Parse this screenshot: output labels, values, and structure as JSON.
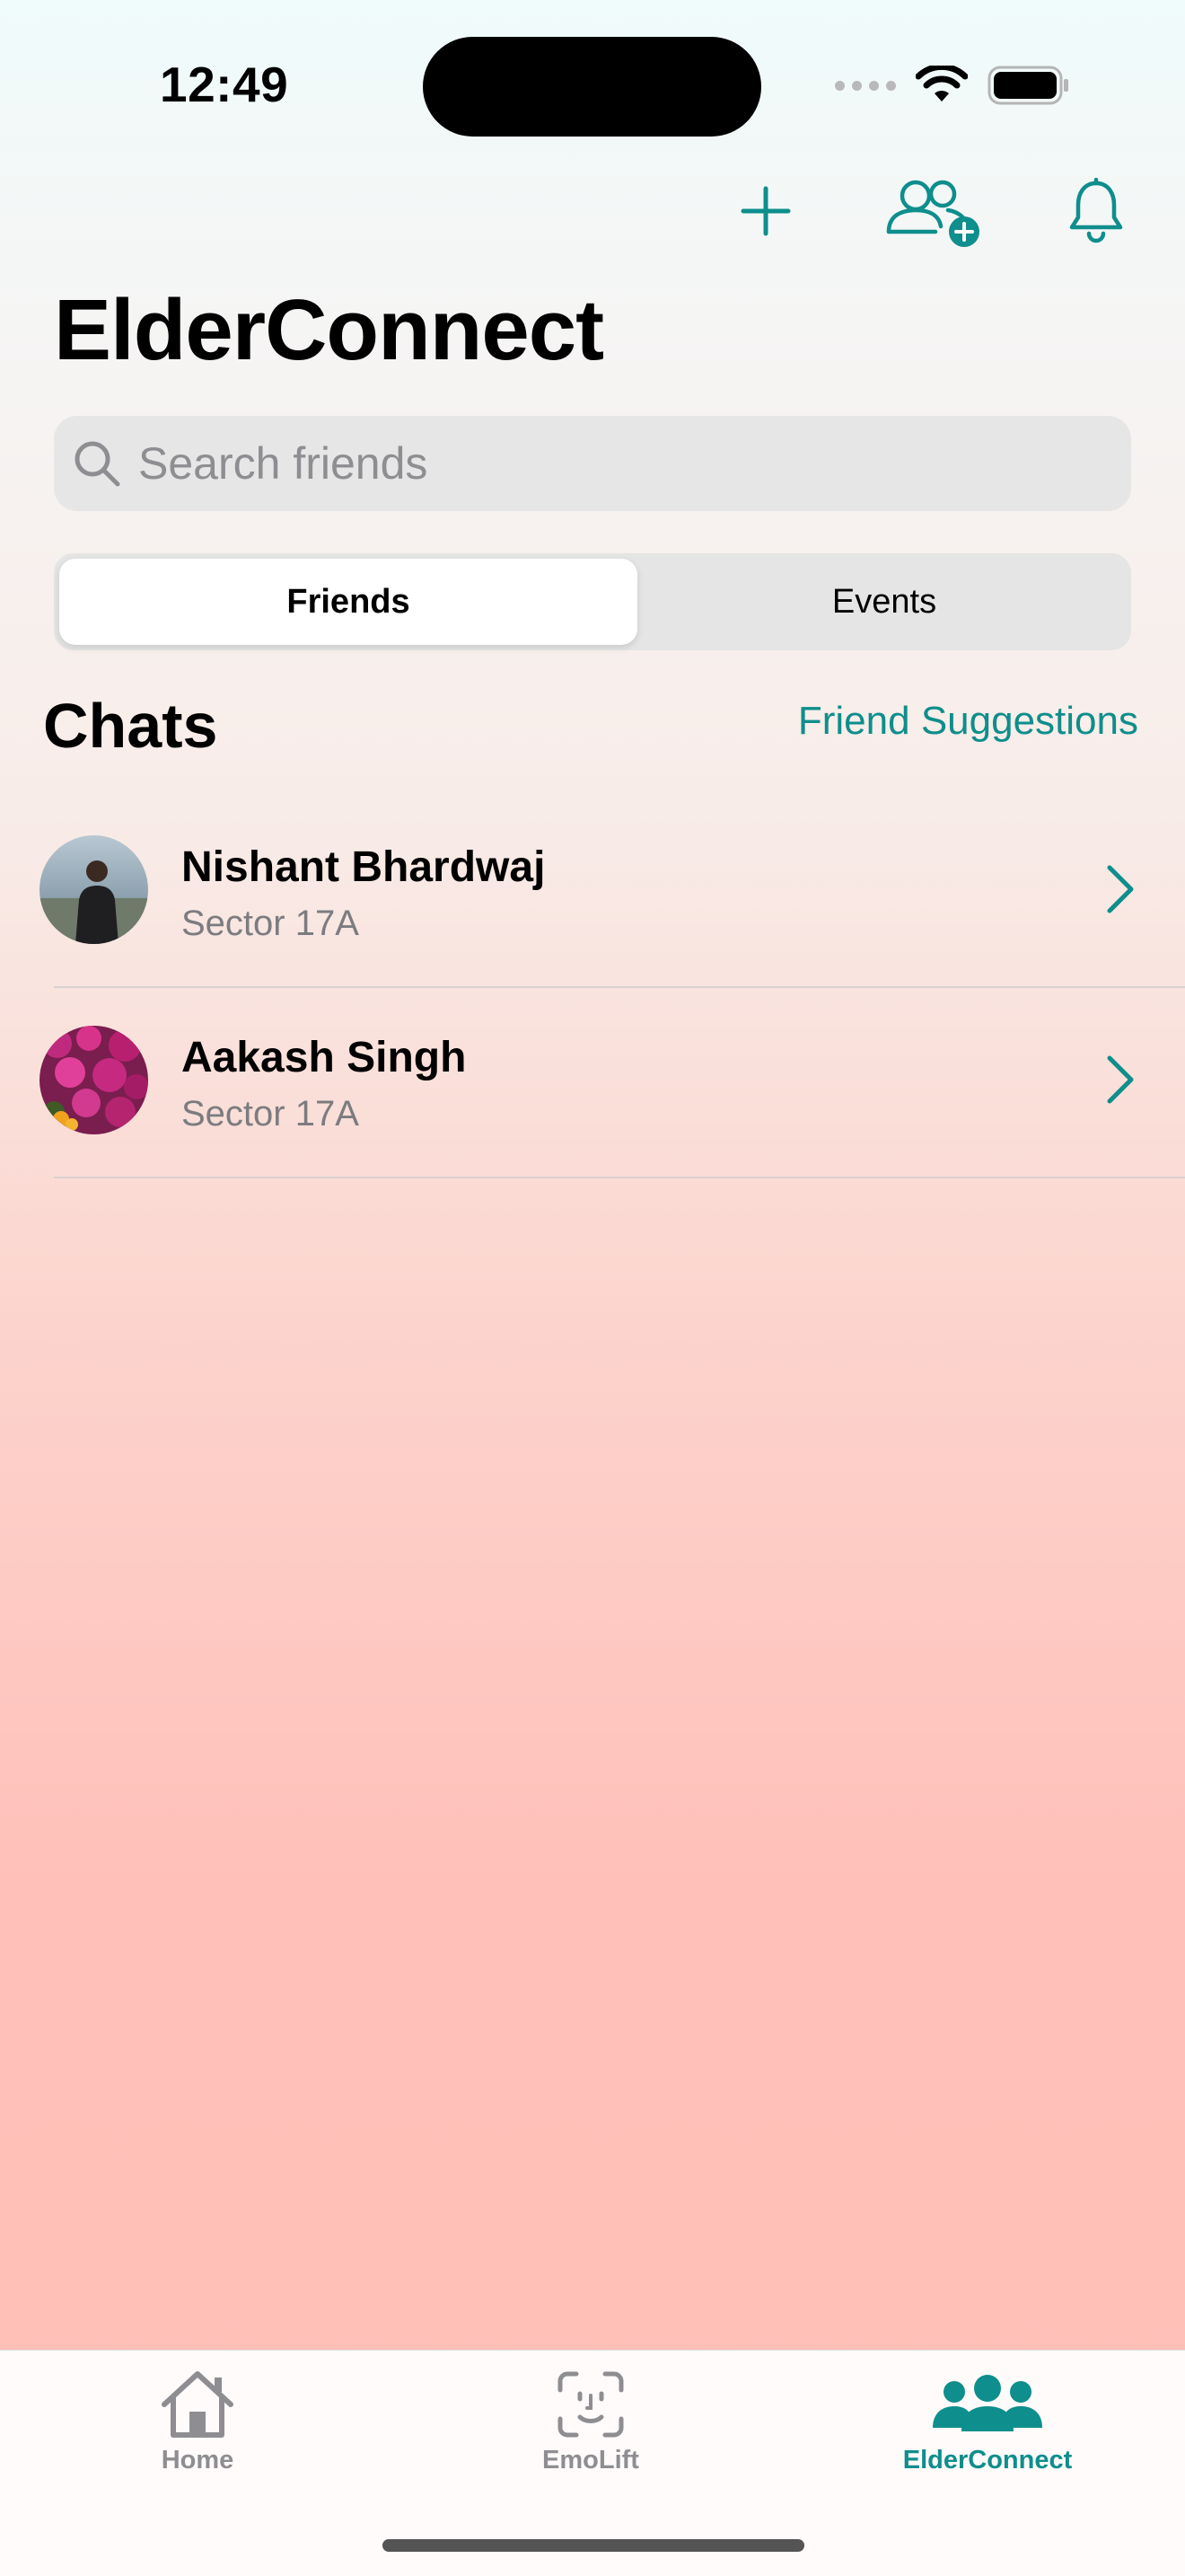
{
  "status_bar": {
    "time": "12:49"
  },
  "header": {
    "title": "ElderConnect"
  },
  "search": {
    "placeholder": "Search friends"
  },
  "segments": {
    "friends": "Friends",
    "events": "Events",
    "selected": "Friends"
  },
  "chats": {
    "title": "Chats",
    "suggestions_label": "Friend Suggestions",
    "items": [
      {
        "name": "Nishant Bhardwaj",
        "location": "Sector 17A"
      },
      {
        "name": "Aakash Singh",
        "location": "Sector 17A"
      }
    ]
  },
  "tabbar": {
    "tabs": [
      {
        "label": "Home",
        "icon": "house-icon"
      },
      {
        "label": "EmoLift",
        "icon": "face-scan-icon"
      },
      {
        "label": "ElderConnect",
        "icon": "people-icon"
      }
    ],
    "selected": "ElderConnect"
  },
  "colors": {
    "accent": "#0e8e8c",
    "inactive": "#8e8e92"
  }
}
